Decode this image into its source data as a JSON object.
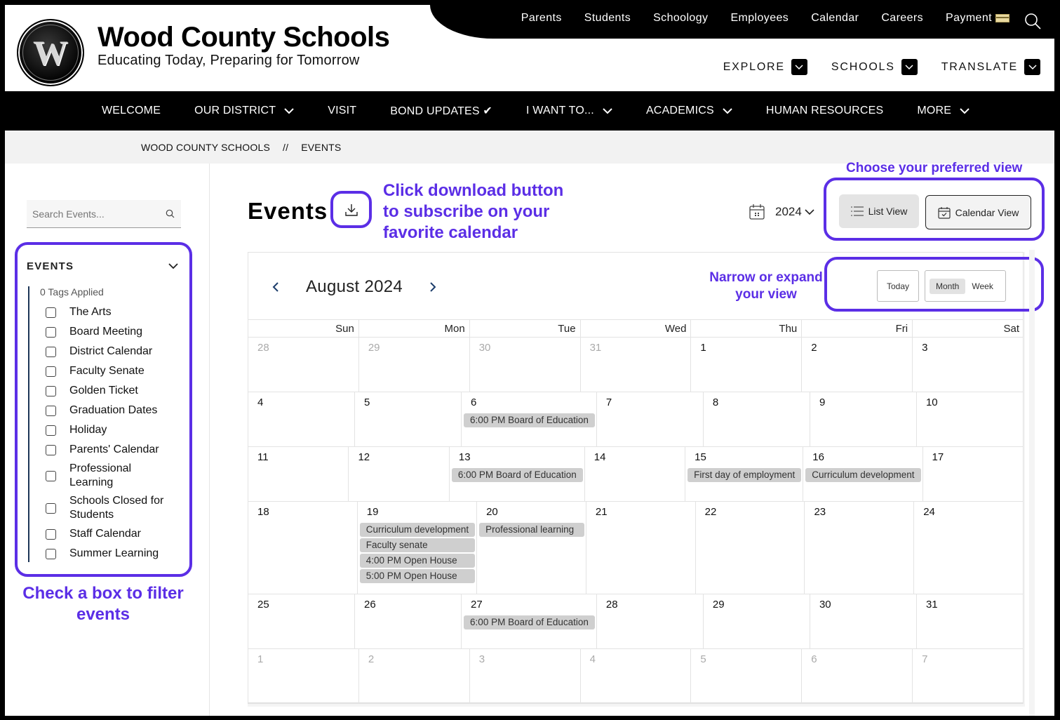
{
  "header": {
    "site_title": "Wood County Schools",
    "tagline": "Educating Today, Preparing for Tomorrow",
    "logo_letter": "W",
    "utility_links": [
      "Parents",
      "Students",
      "Schoology",
      "Employees",
      "Calendar",
      "Careers",
      "Payment"
    ],
    "dropdowns": [
      "EXPLORE",
      "SCHOOLS",
      "TRANSLATE"
    ]
  },
  "mainnav": [
    {
      "label": "WELCOME",
      "has_dropdown": false
    },
    {
      "label": "OUR DISTRICT",
      "has_dropdown": true
    },
    {
      "label": "VISIT",
      "has_dropdown": false
    },
    {
      "label": "BOND UPDATES ✔",
      "has_dropdown": false
    },
    {
      "label": "I WANT TO...",
      "has_dropdown": true
    },
    {
      "label": "ACADEMICS",
      "has_dropdown": true
    },
    {
      "label": "HUMAN RESOURCES",
      "has_dropdown": false
    },
    {
      "label": "MORE",
      "has_dropdown": true
    }
  ],
  "breadcrumb": {
    "items": [
      "WOOD COUNTY SCHOOLS",
      "EVENTS"
    ],
    "separator": "//"
  },
  "sidebar": {
    "search_placeholder": "Search Events...",
    "filter_title": "EVENTS",
    "tags_applied": "0 Tags Applied",
    "tags": [
      "The Arts",
      "Board Meeting",
      "District Calendar",
      "Faculty Senate",
      "Golden Ticket",
      "Graduation Dates",
      "Holiday",
      "Parents' Calendar",
      "Professional Learning",
      "Schools Closed for Students",
      "Staff Calendar",
      "Summer Learning"
    ]
  },
  "annotations": {
    "filter": "Check a box to filter events",
    "download": "Click download button to subscribe on your favorite calendar",
    "view": "Choose your preferred view",
    "narrow": "Narrow or expand your view",
    "accent_color": "#5b2ee6"
  },
  "main": {
    "title": "Events",
    "year": "2024",
    "list_view": "List View",
    "calendar_view": "Calendar View",
    "month_label": "August 2024",
    "today": "Today",
    "month": "Month",
    "week": "Week",
    "weekdays": [
      "Sun",
      "Mon",
      "Tue",
      "Wed",
      "Thu",
      "Fri",
      "Sat"
    ],
    "weeks": [
      [
        {
          "d": "28",
          "o": true,
          "ev": []
        },
        {
          "d": "29",
          "o": true,
          "ev": []
        },
        {
          "d": "30",
          "o": true,
          "ev": []
        },
        {
          "d": "31",
          "o": true,
          "ev": []
        },
        {
          "d": "1",
          "ev": []
        },
        {
          "d": "2",
          "ev": []
        },
        {
          "d": "3",
          "ev": []
        }
      ],
      [
        {
          "d": "4",
          "ev": []
        },
        {
          "d": "5",
          "ev": []
        },
        {
          "d": "6",
          "ev": [
            "6:00 PM Board of Education"
          ]
        },
        {
          "d": "7",
          "ev": []
        },
        {
          "d": "8",
          "ev": []
        },
        {
          "d": "9",
          "ev": []
        },
        {
          "d": "10",
          "ev": []
        }
      ],
      [
        {
          "d": "11",
          "ev": []
        },
        {
          "d": "12",
          "ev": []
        },
        {
          "d": "13",
          "ev": [
            "6:00 PM Board of Education"
          ]
        },
        {
          "d": "14",
          "ev": []
        },
        {
          "d": "15",
          "ev": [
            "First day of employment"
          ]
        },
        {
          "d": "16",
          "ev": [
            "Curriculum development"
          ]
        },
        {
          "d": "17",
          "ev": []
        }
      ],
      [
        {
          "d": "18",
          "ev": []
        },
        {
          "d": "19",
          "ev": [
            "Curriculum development",
            "Faculty senate",
            "4:00 PM Open House",
            "5:00 PM Open House"
          ]
        },
        {
          "d": "20",
          "ev": [
            "Professional learning"
          ]
        },
        {
          "d": "21",
          "ev": []
        },
        {
          "d": "22",
          "ev": []
        },
        {
          "d": "23",
          "ev": []
        },
        {
          "d": "24",
          "ev": []
        }
      ],
      [
        {
          "d": "25",
          "ev": []
        },
        {
          "d": "26",
          "ev": []
        },
        {
          "d": "27",
          "ev": [
            "6:00 PM Board of Education"
          ]
        },
        {
          "d": "28",
          "ev": []
        },
        {
          "d": "29",
          "ev": []
        },
        {
          "d": "30",
          "ev": []
        },
        {
          "d": "31",
          "ev": []
        }
      ],
      [
        {
          "d": "1",
          "o": true,
          "ev": []
        },
        {
          "d": "2",
          "o": true,
          "ev": []
        },
        {
          "d": "3",
          "o": true,
          "ev": []
        },
        {
          "d": "4",
          "o": true,
          "ev": []
        },
        {
          "d": "5",
          "o": true,
          "ev": []
        },
        {
          "d": "6",
          "o": true,
          "ev": []
        },
        {
          "d": "7",
          "o": true,
          "ev": []
        }
      ]
    ]
  }
}
